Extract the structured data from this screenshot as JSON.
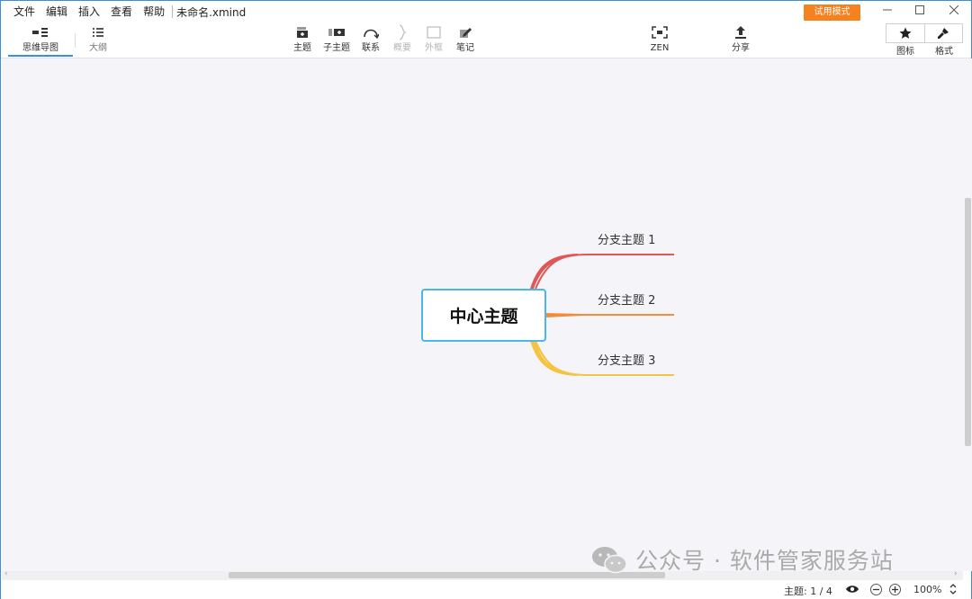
{
  "menu": {
    "items": [
      "文件",
      "编辑",
      "插入",
      "查看",
      "帮助"
    ],
    "filename": "未命名.xmind"
  },
  "trial_button": "试用模式",
  "window_controls": {
    "minimize": "—",
    "maximize": "☐",
    "close": "✕"
  },
  "view_tabs": [
    {
      "label": "思维导图",
      "active": true
    },
    {
      "label": "大纲",
      "active": false
    }
  ],
  "tools": {
    "topic": "主题",
    "subtopic": "子主题",
    "relationship": "联系",
    "summary": "概要",
    "boundary": "外框",
    "note": "笔记",
    "zen": "ZEN",
    "share": "分享"
  },
  "right_panel": {
    "icons": "图标",
    "format": "格式"
  },
  "map": {
    "central": "中心主题",
    "branches": [
      {
        "label": "分支主题 1",
        "color": "#e05757"
      },
      {
        "label": "分支主题 2",
        "color": "#f08c3a"
      },
      {
        "label": "分支主题 3",
        "color": "#f5c342"
      }
    ],
    "central_border": "#4bb6e8"
  },
  "status": {
    "topic_count": "主题: 1 / 4",
    "zoom": "100%"
  },
  "watermark": "公众号 · 软件管家服务站",
  "colors": {
    "accent": "#3a8fd6",
    "trial": "#f5811f",
    "canvas": "#f5f5f9"
  }
}
